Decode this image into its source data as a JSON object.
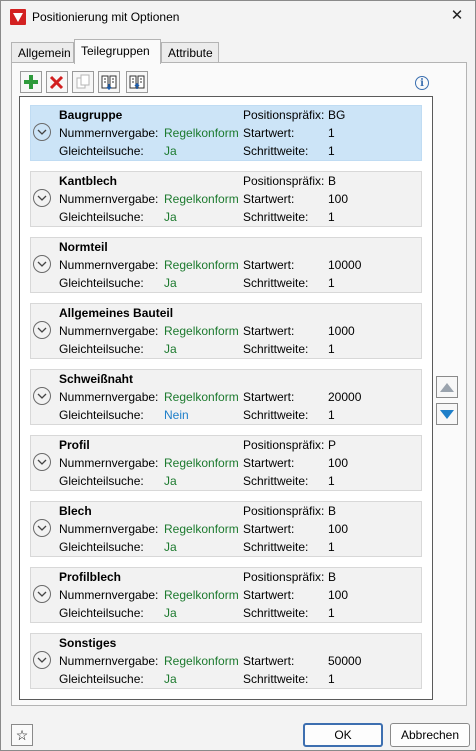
{
  "window": {
    "title": "Positionierung mit Optionen",
    "close_icon": "close-icon"
  },
  "tabs": [
    {
      "label": "Allgemein"
    },
    {
      "label": "Teilegruppen",
      "active": true
    },
    {
      "label": "Attribute"
    }
  ],
  "toolbar": {
    "icons": [
      "add-icon",
      "delete-icon",
      "copy-icon",
      "import-icon",
      "export-icon"
    ],
    "info_icon": "info-icon"
  },
  "labels": {
    "nummernvergabe": "Nummernvergabe:",
    "gleichteilsuche": "Gleichteilsuche:",
    "positionspraefix": "Positionspräfix:",
    "startwert": "Startwert:",
    "schrittweite": "Schrittweite:"
  },
  "groups": [
    {
      "name": "Baugruppe",
      "nummernvergabe": "Regelkonform",
      "gleichteilsuche": "Ja",
      "k1": "Positionspräfix:",
      "v1": "BG",
      "k2": "Startwert:",
      "v2": "1",
      "k3": "Schrittweite:",
      "v3": "1",
      "selected": true
    },
    {
      "name": "Kantblech",
      "nummernvergabe": "Regelkonform",
      "gleichteilsuche": "Ja",
      "k1": "Positionspräfix:",
      "v1": "B",
      "k2": "Startwert:",
      "v2": "100",
      "k3": "Schrittweite:",
      "v3": "1"
    },
    {
      "name": "Normteil",
      "nummernvergabe": "Regelkonform",
      "gleichteilsuche": "Ja",
      "k1": "",
      "v1": "",
      "k2": "Startwert:",
      "v2": "10000",
      "k3": "Schrittweite:",
      "v3": "1"
    },
    {
      "name": "Allgemeines Bauteil",
      "nummernvergabe": "Regelkonform",
      "gleichteilsuche": "Ja",
      "k1": "",
      "v1": "",
      "k2": "Startwert:",
      "v2": "1000",
      "k3": "Schrittweite:",
      "v3": "1"
    },
    {
      "name": "Schweißnaht",
      "nummernvergabe": "Regelkonform",
      "gleichteilsuche": "Nein",
      "k1": "",
      "v1": "",
      "k2": "Startwert:",
      "v2": "20000",
      "k3": "Schrittweite:",
      "v3": "1"
    },
    {
      "name": "Profil",
      "nummernvergabe": "Regelkonform",
      "gleichteilsuche": "Ja",
      "k1": "Positionspräfix:",
      "v1": "P",
      "k2": "Startwert:",
      "v2": "100",
      "k3": "Schrittweite:",
      "v3": "1"
    },
    {
      "name": "Blech",
      "nummernvergabe": "Regelkonform",
      "gleichteilsuche": "Ja",
      "k1": "Positionspräfix:",
      "v1": "B",
      "k2": "Startwert:",
      "v2": "100",
      "k3": "Schrittweite:",
      "v3": "1"
    },
    {
      "name": "Profilblech",
      "nummernvergabe": "Regelkonform",
      "gleichteilsuche": "Ja",
      "k1": "Positionspräfix:",
      "v1": "B",
      "k2": "Startwert:",
      "v2": "100",
      "k3": "Schrittweite:",
      "v3": "1"
    },
    {
      "name": "Sonstiges",
      "nummernvergabe": "Regelkonform",
      "gleichteilsuche": "Ja",
      "k1": "",
      "v1": "",
      "k2": "Startwert:",
      "v2": "50000",
      "k3": "Schrittweite:",
      "v3": "1"
    }
  ],
  "colors": {
    "accent_green": "#1c7a2e",
    "accent_blue": "#1e7fc9",
    "selection": "#cce4f7"
  },
  "side_buttons": {
    "up_icon": "arrow-up-icon",
    "down_icon": "arrow-down-icon"
  },
  "footer": {
    "favorite_icon": "star-icon",
    "ok_label": "OK",
    "cancel_label": "Abbrechen"
  }
}
